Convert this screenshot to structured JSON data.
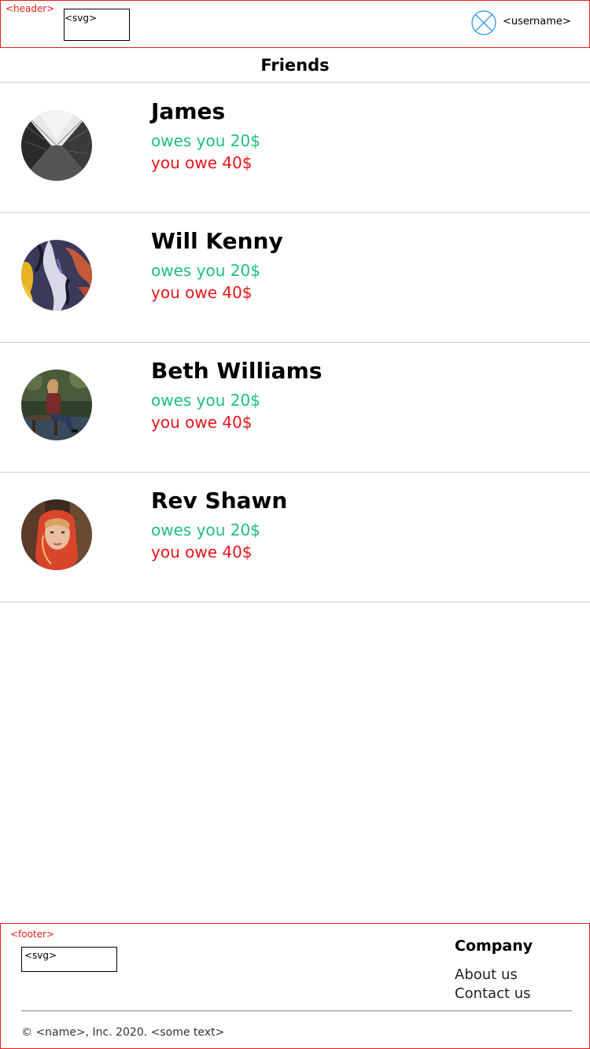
{
  "header": {
    "wireframe_tag": "<header>",
    "logo_placeholder": "<svg>",
    "username": "<username>"
  },
  "page": {
    "title": "Friends"
  },
  "friends": [
    {
      "name": "James",
      "owes_you": "owes you 20$",
      "you_owe": "you owe 40$",
      "avatar": "photo-skyscrapers"
    },
    {
      "name": "Will Kenny",
      "owes_you": "owes you 20$",
      "you_owe": "you owe 40$",
      "avatar": "photo-abstract-paint"
    },
    {
      "name": "Beth Williams",
      "owes_you": "owes you 20$",
      "you_owe": "you owe 40$",
      "avatar": "photo-person-on-bench"
    },
    {
      "name": "Rev Shawn",
      "owes_you": "owes you 20$",
      "you_owe": "you owe 40$",
      "avatar": "photo-woman-red-headscarf"
    }
  ],
  "footer": {
    "wireframe_tag": "<footer>",
    "logo_placeholder": "<svg>",
    "company_heading": "Company",
    "links": [
      "About us",
      "Contact us"
    ],
    "copyright": "© <name>, Inc. 2020. <some text>"
  },
  "colors": {
    "wireframe_outline": "#e0201b",
    "owes_you_green": "#1ec07a",
    "you_owe_red": "#e8141b",
    "avatar_placeholder_blue": "#1e90e8"
  }
}
